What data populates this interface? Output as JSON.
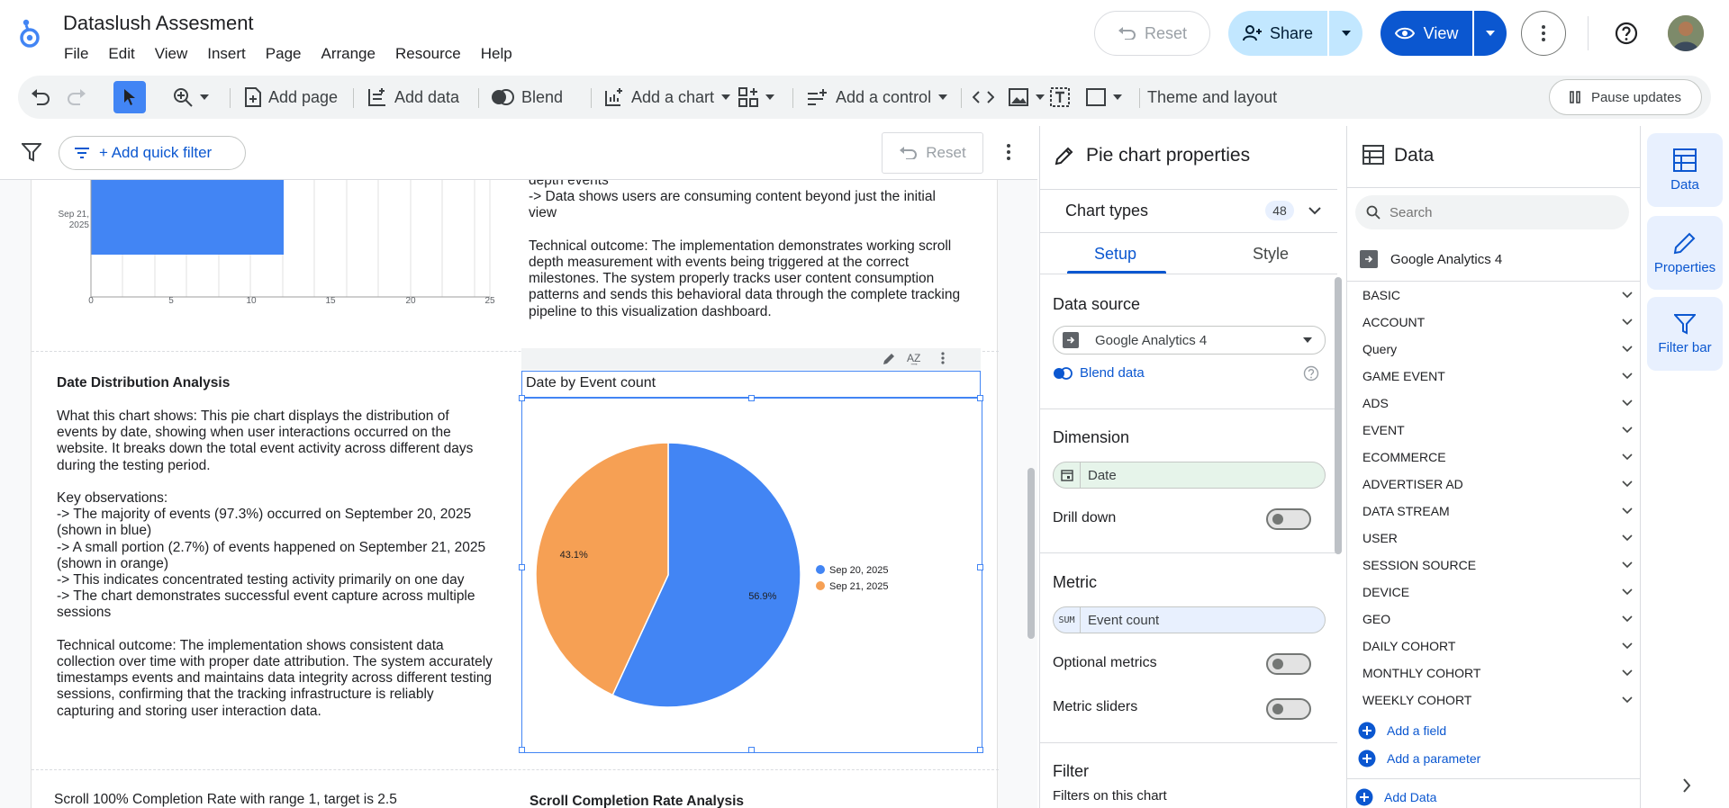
{
  "header": {
    "title": "Dataslush Assesment",
    "menu": [
      "File",
      "Edit",
      "View",
      "Insert",
      "Page",
      "Arrange",
      "Resource",
      "Help"
    ],
    "reset_label": "Reset",
    "share_label": "Share",
    "view_label": "View"
  },
  "toolbar": {
    "add_page": "Add page",
    "add_data": "Add data",
    "blend": "Blend",
    "add_chart": "Add a chart",
    "add_control": "Add a control",
    "theme_layout": "Theme and layout",
    "pause_updates": "Pause updates"
  },
  "filterbar": {
    "add_quick_filter": "+ Add quick filter",
    "reset_label": "Reset"
  },
  "report": {
    "top_bar_chart": {
      "y_label": "Sep 21,\n2025",
      "ticks": [
        "0",
        "5",
        "10",
        "15",
        "20",
        "25"
      ]
    },
    "top_text": "depth events\n-> Data shows users are consuming content beyond just the initial\nview\n\nTechnical outcome: The implementation demonstrates working scroll\ndepth measurement with events being triggered at the correct\nmilestones. The system properly tracks user content consumption\npatterns and sends this behavioral data through the complete tracking\npipeline to this visualization dashboard.",
    "section_title": "Date Distribution Analysis",
    "section_body": "What this chart shows: This pie chart displays the distribution of\nevents by date, showing when user interactions occurred on the\nwebsite. It breaks down the total event activity across different days\nduring the testing period.\n\nKey observations:\n-> The majority of events (97.3%) occurred on September 20, 2025\n(shown in blue)\n-> A small portion (2.7%) of events happened on September 21, 2025\n(shown in orange)\n-> This indicates concentrated testing activity primarily on one day\n-> The chart demonstrates successful event capture across multiple\nsessions\n\nTechnical outcome: The implementation shows consistent data\ncollection over time with proper date attribution. The system accurately\ntimestamps events and maintains data integrity across different testing\nsessions, confirming that the tracking infrastructure is reliably\ncapturing and storing user interaction data.",
    "bottom_left": "Scroll 100% Completion Rate with range 1, target is 2.5",
    "bottom_right": "Scroll Completion Rate Analysis"
  },
  "chart_data": {
    "type": "pie",
    "title": "Date by Event count",
    "categories": [
      "Sep 20, 2025",
      "Sep 21, 2025"
    ],
    "values": [
      56.9,
      43.1
    ],
    "labels": [
      "56.9%",
      "43.1%"
    ],
    "colors": [
      "#4285f4",
      "#f6a054"
    ],
    "legend": "right"
  },
  "props": {
    "title": "Pie chart properties",
    "chart_types": "Chart types",
    "chart_types_count": "48",
    "tab_setup": "Setup",
    "tab_style": "Style",
    "data_source_title": "Data source",
    "data_source": "Google Analytics 4",
    "blend_data": "Blend data",
    "dimension_title": "Dimension",
    "dimension": "Date",
    "drill_down": "Drill down",
    "metric_title": "Metric",
    "metric_agg": "SUM",
    "metric": "Event count",
    "optional_metrics": "Optional metrics",
    "metric_sliders": "Metric sliders",
    "filter_title": "Filter",
    "filters_on_chart": "Filters on this chart"
  },
  "data_panel": {
    "title": "Data",
    "search_placeholder": "Search",
    "source": "Google Analytics 4",
    "categories": [
      "BASIC",
      "ACCOUNT",
      "Query",
      "GAME EVENT",
      "ADS",
      "EVENT",
      "ECOMMERCE",
      "ADVERTISER AD",
      "DATA STREAM",
      "USER",
      "SESSION SOURCE",
      "DEVICE",
      "GEO",
      "DAILY COHORT",
      "MONTHLY COHORT",
      "WEEKLY COHORT"
    ],
    "add_field": "Add a field",
    "add_parameter": "Add a parameter",
    "add_data": "Add Data"
  },
  "rail": {
    "data": "Data",
    "properties": "Properties",
    "filter_bar": "Filter bar"
  },
  "colors": {
    "accent": "#0b57d0",
    "share_bg": "#c2e7ff",
    "view_bg": "#0b57d0"
  }
}
